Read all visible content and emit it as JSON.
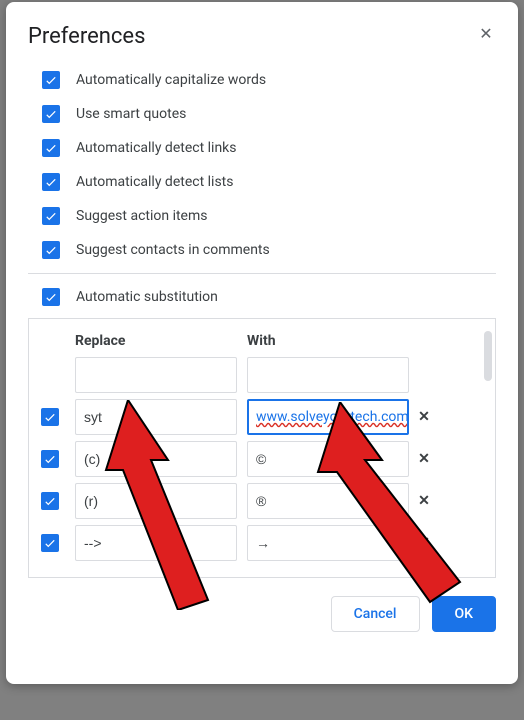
{
  "dialog_title": "Preferences",
  "prefs": {
    "p0": "Automatically capitalize words",
    "p1": "Use smart quotes",
    "p2": "Automatically detect links",
    "p3": "Automatically detect lists",
    "p4": "Suggest action items",
    "p5": "Suggest contacts in comments"
  },
  "subst_label": "Automatic substitution",
  "table": {
    "replace_header": "Replace",
    "with_header": "With",
    "rows": {
      "r0": {
        "replace": "",
        "with": ""
      },
      "r1": {
        "replace": "syt",
        "with": "www.solveyourtech.com"
      },
      "r2": {
        "replace": "(c)",
        "with": "©"
      },
      "r3": {
        "replace": "(r)",
        "with": "®"
      },
      "r4": {
        "replace": "-->",
        "with": "→"
      }
    }
  },
  "buttons": {
    "cancel": "Cancel",
    "ok": "OK"
  }
}
